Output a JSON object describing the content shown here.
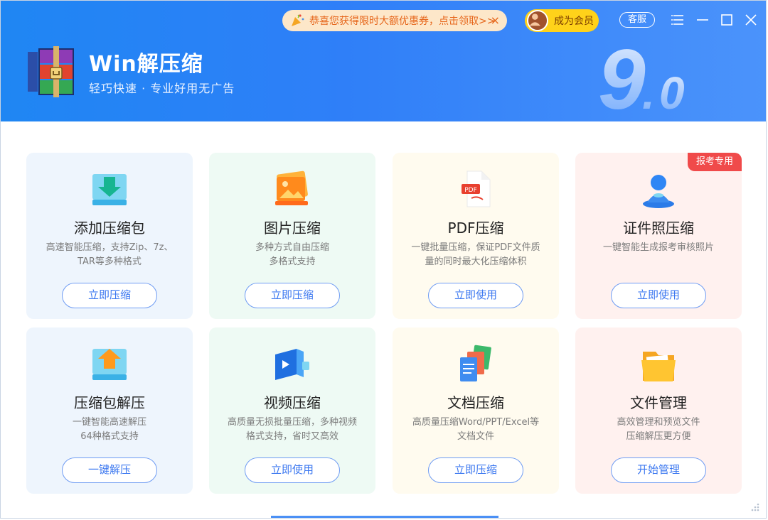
{
  "app": {
    "title": "Win解压缩",
    "subtitle": "轻巧快速 · 专业好用无广告",
    "version_mark": "9.0"
  },
  "topbar": {
    "promo_text": "恭喜您获得限时大额优惠券，点击领取>>",
    "promo_close": "×",
    "member_label": "成为会员",
    "service_label": "客服"
  },
  "cards": [
    {
      "title": "添加压缩包",
      "desc1": "高速智能压缩，支持Zip、7z、",
      "desc2": "TAR等多种格式",
      "button": "立即压缩",
      "icon": "add-archive-icon"
    },
    {
      "title": "图片压缩",
      "desc1": "多种方式自由压缩",
      "desc2": "多格式支持",
      "button": "立即压缩",
      "icon": "image-icon"
    },
    {
      "title": "PDF压缩",
      "desc1": "一键批量压缩，保证PDF文件质",
      "desc2": "量的同时最大化压缩体积",
      "button": "立即使用",
      "icon": "pdf-icon"
    },
    {
      "title": "证件照压缩",
      "desc1": "一键智能生成报考审核照片",
      "desc2": "",
      "button": "立即使用",
      "icon": "id-photo-icon",
      "badge": "报考专用"
    },
    {
      "title": "压缩包解压",
      "desc1": "一键智能高速解压",
      "desc2": "64种格式支持",
      "button": "一键解压",
      "icon": "extract-icon"
    },
    {
      "title": "视频压缩",
      "desc1": "高质量无损批量压缩，多种视频",
      "desc2": "格式支持，省时又高效",
      "button": "立即使用",
      "icon": "video-icon"
    },
    {
      "title": "文档压缩",
      "desc1": "高质量压缩Word/PPT/Excel等",
      "desc2": "文档文件",
      "button": "立即压缩",
      "icon": "document-icon"
    },
    {
      "title": "文件管理",
      "desc1": "高效管理和预览文件",
      "desc2": "压缩解压更方便",
      "button": "开始管理",
      "icon": "folder-icon"
    }
  ],
  "colors": {
    "header_start": "#1f86f3",
    "header_end": "#4b93fb",
    "button_text": "#3c78f0",
    "badge": "#f04a4a"
  }
}
